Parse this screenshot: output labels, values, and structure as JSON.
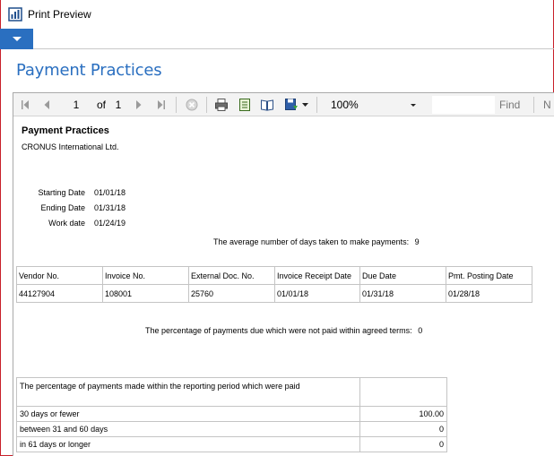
{
  "window": {
    "title": "Print Preview"
  },
  "page_title": "Payment Practices",
  "toolbar": {
    "page_current": "1",
    "page_of_label": "of",
    "page_total": "1",
    "zoom": "100%",
    "find_label": "Find",
    "next_label": "N"
  },
  "report": {
    "title": "Payment Practices",
    "company": "CRONUS International Ltd.",
    "fields": [
      {
        "label": "Starting Date",
        "value": "01/01/18"
      },
      {
        "label": "Ending Date",
        "value": "01/31/18"
      },
      {
        "label": "Work date",
        "value": "01/24/19"
      }
    ],
    "avg_days_label": "The average number of days taken to make payments:",
    "avg_days_value": "9",
    "vendor_table": {
      "headers": [
        "Vendor No.",
        "Invoice No.",
        "External Doc. No.",
        "Invoice Receipt Date",
        "Due Date",
        "Pmt. Posting Date"
      ],
      "rows": [
        [
          "44127904",
          "108001",
          "25760",
          "01/01/18",
          "01/31/18",
          "01/28/18"
        ]
      ]
    },
    "pct_not_paid_label": "The percentage of payments due which were not paid within agreed terms:",
    "pct_not_paid_value": "0",
    "period_table": {
      "header": "The percentage of payments made within the reporting period which were paid",
      "rows": [
        {
          "label": "30 days or fewer",
          "value": "100.00"
        },
        {
          "label": "between 31 and 60 days",
          "value": "0"
        },
        {
          "label": "in 61 days or longer",
          "value": "0"
        }
      ]
    }
  },
  "colors": {
    "accent": "#2a6fc0",
    "frame": "#c8202a"
  },
  "icons": [
    "print-preview-app-icon",
    "ribbon-dropdown-icon",
    "first-page-icon",
    "previous-page-icon",
    "next-page-icon",
    "last-page-icon",
    "stop-icon",
    "print-icon",
    "page-setup-icon",
    "print-layout-icon",
    "export-icon",
    "dropdown-arrow-icon"
  ]
}
